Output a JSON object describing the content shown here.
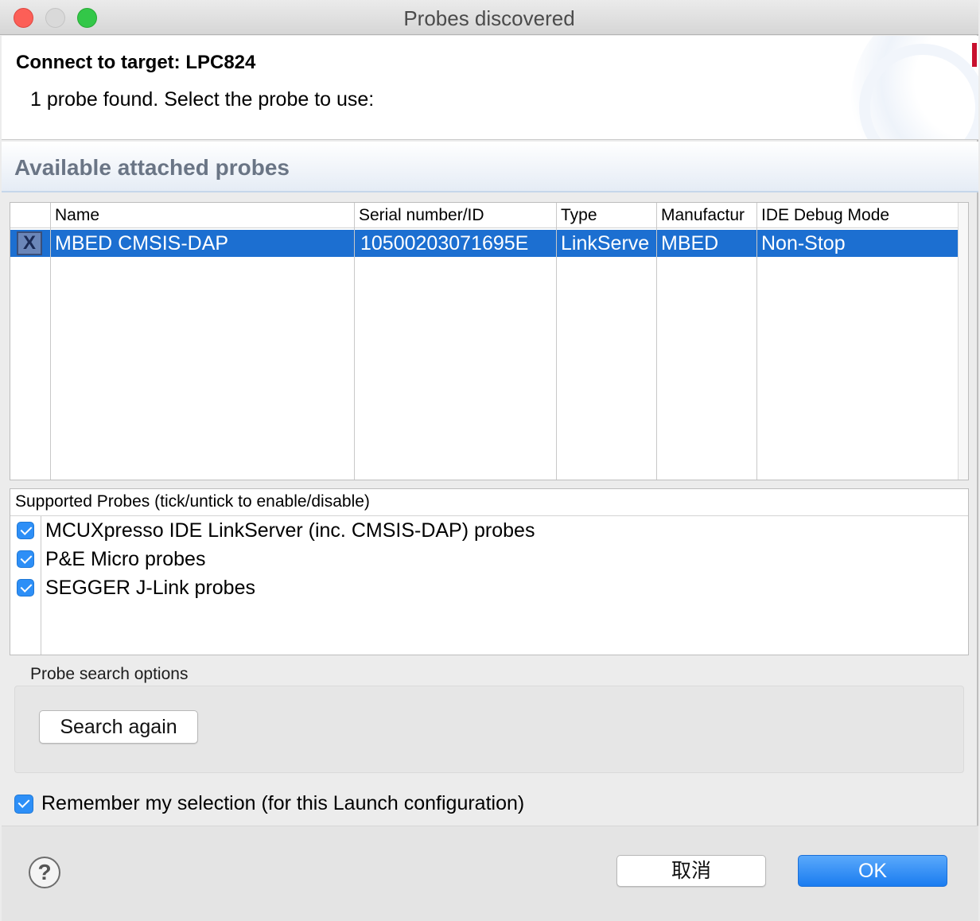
{
  "window": {
    "title": "Probes discovered"
  },
  "header": {
    "title": "Connect to target: LPC824",
    "message": "1 probe found. Select the probe to use:"
  },
  "section": {
    "title": "Available attached probes"
  },
  "probe_table": {
    "columns": [
      "",
      "Name",
      "Serial number/ID",
      "Type",
      "Manufactur",
      "IDE Debug Mode"
    ],
    "rows": [
      {
        "icon": "X",
        "name": "MBED CMSIS-DAP",
        "serial": "10500203071695E",
        "type": "LinkServe",
        "manufacturer": "MBED",
        "mode": "Non-Stop",
        "selected": true
      }
    ]
  },
  "supported": {
    "header": "Supported Probes (tick/untick to enable/disable)",
    "items": [
      {
        "label": "MCUXpresso IDE LinkServer (inc. CMSIS-DAP) probes",
        "checked": true
      },
      {
        "label": "P&E Micro probes",
        "checked": true
      },
      {
        "label": "SEGGER J-Link probes",
        "checked": true
      }
    ]
  },
  "search": {
    "group_label": "Probe search options",
    "button_label": "Search again"
  },
  "remember": {
    "label": "Remember my selection (for this Launch configuration)",
    "checked": true
  },
  "footer": {
    "help_icon": "?",
    "cancel_label": "取消",
    "ok_label": "OK"
  },
  "colors": {
    "selection": "#1c6fd1",
    "checkbox": "#2d8ff7",
    "ok_button": "#1a7cf0",
    "section_title": "#6a7585"
  }
}
